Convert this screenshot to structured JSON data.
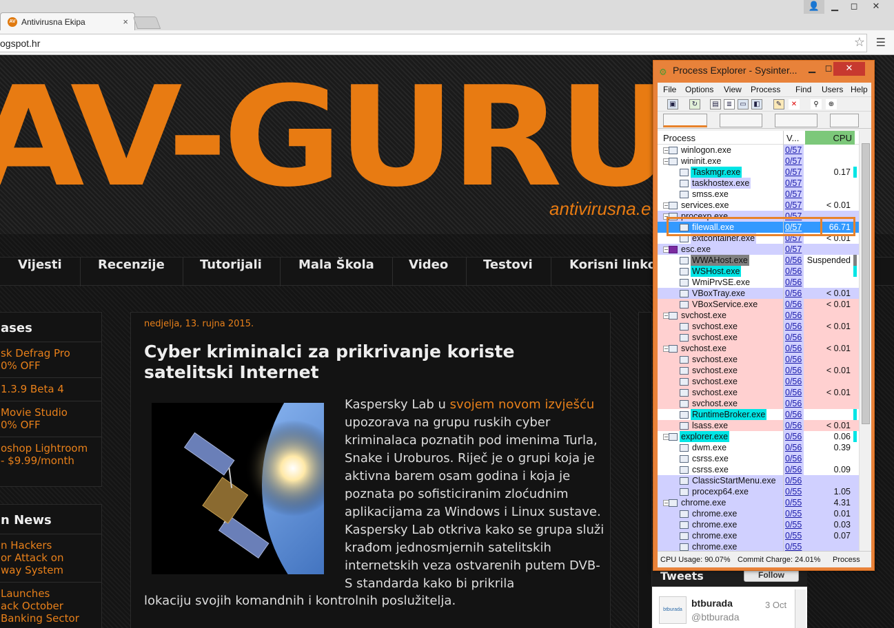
{
  "browser": {
    "tab_title": "Antivirusna Ekipa",
    "tab_close": "×",
    "url": "ogspot.hr",
    "favicon_text": "AV"
  },
  "site": {
    "logo": "AV-GURU",
    "logo_sub": "antivirusna.e",
    "nav": [
      "Vijesti",
      "Recenzije",
      "Tutorijali",
      "Mala Škola",
      "Video",
      "Testovi",
      "Korisni linko"
    ],
    "releases_title": "ases",
    "releases": [
      {
        "l1": "sk Defrag Pro",
        "l2": "0% OFF"
      },
      {
        "l1": "1.3.9 Beta 4",
        "l2": ""
      },
      {
        "l1": "Movie Studio",
        "l2": "0% OFF"
      },
      {
        "l1": "oshop Lightroom",
        "l2": "- $9.99/month"
      }
    ],
    "news_title": "n News",
    "news": [
      {
        "l1": "n Hackers",
        "l2": "or Attack on",
        "l3": "way System"
      },
      {
        "l1": "Launches",
        "l2": "ack October",
        "l3": "Banking Sector"
      }
    ],
    "post": {
      "date": "nedjelja, 13. rujna 2015.",
      "title": "Cyber kriminalci za prikrivanje koriste satelitski Internet",
      "p1": "Kaspersky Lab u ",
      "link": "svojem novom izvješću",
      "p2": " upozorava na grupu ruskih cyber kriminalaca poznatih pod imenima Turla, Snake i Uroburos. Riječ je o grupi koja je aktivna barem osam godina i koja je poznata po sofisticiranim zloćudnim aplikacijama za Windows i Linux sustave. Kaspersky Lab otkriva kako se grupa služi krađom jednosmjernih satelitskih internetskih veza ostvarenih putem DVB-S standarda kako bi prikrila",
      "tail": "lokaciju svojih komandnih i kontrolnih poslužitelja."
    },
    "tweets": {
      "title": "Tweets",
      "follow": "Follow",
      "avatar_text": "btburada",
      "name": "btburada",
      "handle": "@btburada",
      "date": "3 Oct"
    }
  },
  "procexp": {
    "title": "Process Explorer - Sysinter...",
    "menu": [
      "File",
      "Options",
      "View",
      "Process",
      "Find",
      "Users",
      "Help"
    ],
    "col_process": "Process",
    "col_v": "V...",
    "col_cpu": "CPU",
    "rows": [
      {
        "name": "winlogon.exe",
        "tree": "−",
        "ind": 0,
        "v": "0/57",
        "cpu": "",
        "bg": "#ffffff",
        "rbg": "#ffffff"
      },
      {
        "name": "wininit.exe",
        "tree": "−",
        "ind": 0,
        "v": "0/57",
        "cpu": "",
        "bg": "#ffffff",
        "rbg": "#ffffff"
      },
      {
        "name": "Taskmgr.exe",
        "tree": "",
        "ind": 1,
        "v": "0/57",
        "cpu": "0.17",
        "bg": "#00e5e5",
        "rbg": "#ffffff",
        "mark": "#00e5e5"
      },
      {
        "name": "taskhostex.exe",
        "tree": "",
        "ind": 1,
        "v": "0/57",
        "cpu": "",
        "bg": "#d0d0ff",
        "rbg": "#ffffff"
      },
      {
        "name": "smss.exe",
        "tree": "",
        "ind": 1,
        "v": "0/57",
        "cpu": "",
        "bg": "#ffffff",
        "rbg": "#ffffff"
      },
      {
        "name": "services.exe",
        "tree": "−",
        "ind": 0,
        "v": "0/57",
        "cpu": "< 0.01",
        "bg": "#ffffff",
        "rbg": "#ffffff"
      },
      {
        "name": "procexp.exe",
        "tree": "−",
        "ind": 0,
        "v": "0/57",
        "cpu": "",
        "bg": "#d0d0ff",
        "rbg": "#d0d0ff"
      },
      {
        "name": "filewall.exe",
        "tree": "",
        "ind": 1,
        "v": "0/57",
        "cpu": "66.71",
        "bg": "#3399ff",
        "rbg": "#3399ff",
        "sel": true
      },
      {
        "name": "extcontainer.exe",
        "tree": "",
        "ind": 1,
        "v": "0/57",
        "cpu": "< 0.01",
        "bg": "#d0d0ff",
        "rbg": "#ffffff"
      },
      {
        "name": "esc.exe",
        "tree": "−",
        "ind": 0,
        "v": "0/57",
        "cpu": "",
        "bg": "#d0d0ff",
        "rbg": "#d0d0ff",
        "sico": true
      },
      {
        "name": "WWAHost.exe",
        "tree": "",
        "ind": 1,
        "v": "0/56",
        "cpu": "Suspended",
        "bg": "#808080",
        "rbg": "#ffffff",
        "mark": "#808080"
      },
      {
        "name": "WSHost.exe",
        "tree": "",
        "ind": 1,
        "v": "0/56",
        "cpu": "",
        "bg": "#00e5e5",
        "rbg": "#ffffff",
        "mark": "#00e5e5"
      },
      {
        "name": "WmiPrvSE.exe",
        "tree": "",
        "ind": 1,
        "v": "0/56",
        "cpu": "",
        "bg": "#ffffff",
        "rbg": "#ffffff"
      },
      {
        "name": "VBoxTray.exe",
        "tree": "",
        "ind": 1,
        "v": "0/56",
        "cpu": "< 0.01",
        "bg": "#d0d0ff",
        "rbg": "#d0d0ff"
      },
      {
        "name": "VBoxService.exe",
        "tree": "",
        "ind": 1,
        "v": "0/56",
        "cpu": "< 0.01",
        "bg": "#ffd0d0",
        "rbg": "#ffd0d0"
      },
      {
        "name": "svchost.exe",
        "tree": "−",
        "ind": 0,
        "v": "0/56",
        "cpu": "",
        "bg": "#ffd0d0",
        "rbg": "#ffd0d0"
      },
      {
        "name": "svchost.exe",
        "tree": "",
        "ind": 1,
        "v": "0/56",
        "cpu": "< 0.01",
        "bg": "#ffd0d0",
        "rbg": "#ffd0d0"
      },
      {
        "name": "svchost.exe",
        "tree": "",
        "ind": 1,
        "v": "0/56",
        "cpu": "",
        "bg": "#ffd0d0",
        "rbg": "#ffd0d0"
      },
      {
        "name": "svchost.exe",
        "tree": "−",
        "ind": 0,
        "v": "0/56",
        "cpu": "< 0.01",
        "bg": "#ffd0d0",
        "rbg": "#ffd0d0"
      },
      {
        "name": "svchost.exe",
        "tree": "",
        "ind": 1,
        "v": "0/56",
        "cpu": "",
        "bg": "#ffd0d0",
        "rbg": "#ffd0d0"
      },
      {
        "name": "svchost.exe",
        "tree": "",
        "ind": 1,
        "v": "0/56",
        "cpu": "< 0.01",
        "bg": "#ffd0d0",
        "rbg": "#ffd0d0"
      },
      {
        "name": "svchost.exe",
        "tree": "",
        "ind": 1,
        "v": "0/56",
        "cpu": "",
        "bg": "#ffd0d0",
        "rbg": "#ffd0d0"
      },
      {
        "name": "svchost.exe",
        "tree": "",
        "ind": 1,
        "v": "0/56",
        "cpu": "< 0.01",
        "bg": "#ffd0d0",
        "rbg": "#ffd0d0"
      },
      {
        "name": "svchost.exe",
        "tree": "",
        "ind": 1,
        "v": "0/56",
        "cpu": "",
        "bg": "#ffd0d0",
        "rbg": "#ffd0d0"
      },
      {
        "name": "RuntimeBroker.exe",
        "tree": "",
        "ind": 1,
        "v": "0/56",
        "cpu": "",
        "bg": "#00e5e5",
        "rbg": "#ffffff",
        "mark": "#00e5e5"
      },
      {
        "name": "lsass.exe",
        "tree": "",
        "ind": 1,
        "v": "0/56",
        "cpu": "< 0.01",
        "bg": "#ffd0d0",
        "rbg": "#ffd0d0"
      },
      {
        "name": "explorer.exe",
        "tree": "−",
        "ind": 0,
        "v": "0/56",
        "cpu": "0.06",
        "bg": "#00e5e5",
        "rbg": "#ffffff",
        "mark": "#00e5e5"
      },
      {
        "name": "dwm.exe",
        "tree": "",
        "ind": 1,
        "v": "0/56",
        "cpu": "0.39",
        "bg": "#ffffff",
        "rbg": "#ffffff"
      },
      {
        "name": "csrss.exe",
        "tree": "",
        "ind": 1,
        "v": "0/56",
        "cpu": "",
        "bg": "#ffffff",
        "rbg": "#ffffff"
      },
      {
        "name": "csrss.exe",
        "tree": "",
        "ind": 1,
        "v": "0/56",
        "cpu": "0.09",
        "bg": "#ffffff",
        "rbg": "#ffffff"
      },
      {
        "name": "ClassicStartMenu.exe",
        "tree": "",
        "ind": 1,
        "v": "0/56",
        "cpu": "",
        "bg": "#d0d0ff",
        "rbg": "#d0d0ff"
      },
      {
        "name": "procexp64.exe",
        "tree": "",
        "ind": 1,
        "v": "0/55",
        "cpu": "1.05",
        "bg": "#d0d0ff",
        "rbg": "#d0d0ff"
      },
      {
        "name": "chrome.exe",
        "tree": "−",
        "ind": 0,
        "v": "0/55",
        "cpu": "4.31",
        "bg": "#d0d0ff",
        "rbg": "#d0d0ff"
      },
      {
        "name": "chrome.exe",
        "tree": "",
        "ind": 1,
        "v": "0/55",
        "cpu": "0.01",
        "bg": "#d0d0ff",
        "rbg": "#d0d0ff"
      },
      {
        "name": "chrome.exe",
        "tree": "",
        "ind": 1,
        "v": "0/55",
        "cpu": "0.03",
        "bg": "#d0d0ff",
        "rbg": "#d0d0ff"
      },
      {
        "name": "chrome.exe",
        "tree": "",
        "ind": 1,
        "v": "0/55",
        "cpu": "0.07",
        "bg": "#d0d0ff",
        "rbg": "#d0d0ff"
      },
      {
        "name": "chrome.exe",
        "tree": "",
        "ind": 1,
        "v": "0/55",
        "cpu": "",
        "bg": "#d0d0ff",
        "rbg": "#d0d0ff"
      }
    ],
    "status": {
      "cpu": "CPU Usage: 90.07%",
      "commit": "Commit Charge: 24.01%",
      "proc": "Process"
    }
  }
}
